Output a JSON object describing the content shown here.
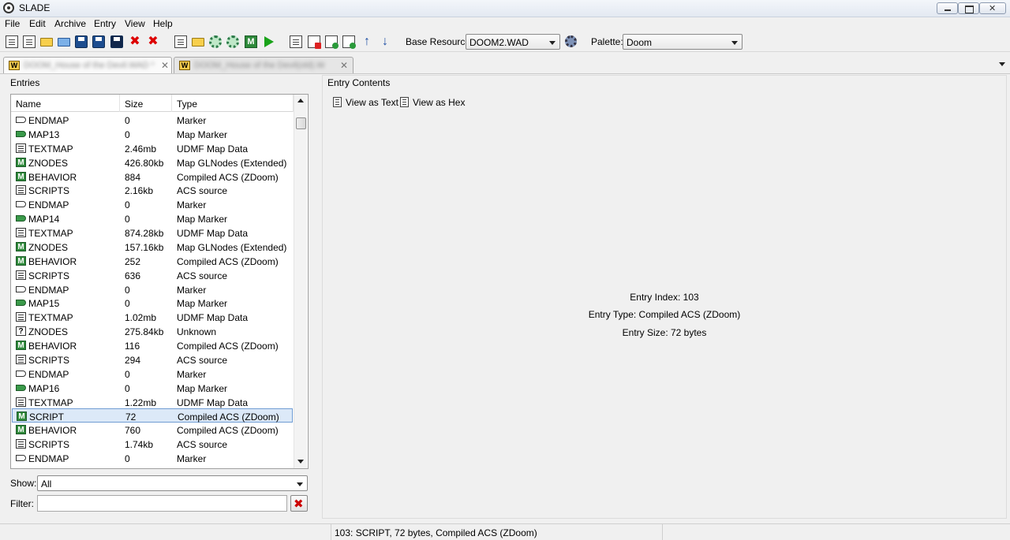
{
  "window": {
    "title": "SLADE"
  },
  "menu": [
    "File",
    "Edit",
    "Archive",
    "Entry",
    "View",
    "Help"
  ],
  "toolbar": {
    "base_resource_label": "Base Resource:",
    "base_resource_value": "DOOM2.WAD",
    "palette_label": "Palette:",
    "palette_value": "Doom"
  },
  "tabs": [
    {
      "label": "DOOM_House of the Devil.WAD *",
      "active": true
    },
    {
      "label": "DOOM_House of the Devil(old).WAD",
      "active": false
    }
  ],
  "entries_panel": {
    "title": "Entries",
    "columns": [
      "Name",
      "Size",
      "Type"
    ],
    "rows": [
      {
        "icon": "marker",
        "name": "ENDMAP",
        "size": "0",
        "type": "Marker"
      },
      {
        "icon": "map-marker",
        "name": "MAP13",
        "size": "0",
        "type": "Map Marker"
      },
      {
        "icon": "text",
        "name": "TEXTMAP",
        "size": "2.46mb",
        "type": "UDMF Map Data"
      },
      {
        "icon": "m",
        "name": "ZNODES",
        "size": "426.80kb",
        "type": "Map GLNodes (Extended)"
      },
      {
        "icon": "m",
        "name": "BEHAVIOR",
        "size": "884",
        "type": "Compiled ACS (ZDoom)"
      },
      {
        "icon": "text",
        "name": "SCRIPTS",
        "size": "2.16kb",
        "type": "ACS source"
      },
      {
        "icon": "marker",
        "name": "ENDMAP",
        "size": "0",
        "type": "Marker"
      },
      {
        "icon": "map-marker",
        "name": "MAP14",
        "size": "0",
        "type": "Map Marker"
      },
      {
        "icon": "text",
        "name": "TEXTMAP",
        "size": "874.28kb",
        "type": "UDMF Map Data"
      },
      {
        "icon": "m",
        "name": "ZNODES",
        "size": "157.16kb",
        "type": "Map GLNodes (Extended)"
      },
      {
        "icon": "m",
        "name": "BEHAVIOR",
        "size": "252",
        "type": "Compiled ACS (ZDoom)"
      },
      {
        "icon": "text",
        "name": "SCRIPTS",
        "size": "636",
        "type": "ACS source"
      },
      {
        "icon": "marker",
        "name": "ENDMAP",
        "size": "0",
        "type": "Marker"
      },
      {
        "icon": "map-marker",
        "name": "MAP15",
        "size": "0",
        "type": "Map Marker"
      },
      {
        "icon": "text",
        "name": "TEXTMAP",
        "size": "1.02mb",
        "type": "UDMF Map Data"
      },
      {
        "icon": "unknown",
        "name": "ZNODES",
        "size": "275.84kb",
        "type": "Unknown"
      },
      {
        "icon": "m",
        "name": "BEHAVIOR",
        "size": "116",
        "type": "Compiled ACS (ZDoom)"
      },
      {
        "icon": "text",
        "name": "SCRIPTS",
        "size": "294",
        "type": "ACS source"
      },
      {
        "icon": "marker",
        "name": "ENDMAP",
        "size": "0",
        "type": "Marker"
      },
      {
        "icon": "map-marker",
        "name": "MAP16",
        "size": "0",
        "type": "Map Marker"
      },
      {
        "icon": "text",
        "name": "TEXTMAP",
        "size": "1.22mb",
        "type": "UDMF Map Data"
      },
      {
        "icon": "m",
        "name": "SCRIPT",
        "size": "72",
        "type": "Compiled ACS (ZDoom)",
        "selected": true
      },
      {
        "icon": "m",
        "name": "BEHAVIOR",
        "size": "760",
        "type": "Compiled ACS (ZDoom)"
      },
      {
        "icon": "text",
        "name": "SCRIPTS",
        "size": "1.74kb",
        "type": "ACS source"
      },
      {
        "icon": "marker",
        "name": "ENDMAP",
        "size": "0",
        "type": "Marker"
      }
    ],
    "show_label": "Show:",
    "show_value": "All",
    "filter_label": "Filter:",
    "filter_value": ""
  },
  "contents_panel": {
    "title": "Entry Contents",
    "view_as_text": "View as Text",
    "view_as_hex": "View as Hex",
    "entry_index": "Entry Index: 103",
    "entry_type": "Entry Type: Compiled ACS (ZDoom)",
    "entry_size": "Entry Size: 72 bytes"
  },
  "status": {
    "text": "103: SCRIPT, 72 bytes, Compiled ACS (ZDoom)"
  }
}
